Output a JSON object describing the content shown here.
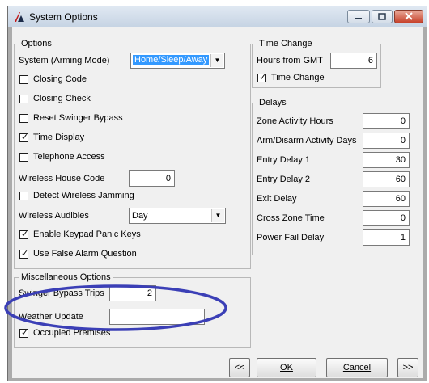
{
  "window": {
    "title": "System Options"
  },
  "options": {
    "legend": "Options",
    "system_label": "System (Arming Mode)",
    "system_value": "Home/Sleep/Away",
    "closing_code": {
      "label": "Closing Code",
      "checked": false
    },
    "closing_check": {
      "label": "Closing Check",
      "checked": false
    },
    "reset_swinger": {
      "label": "Reset Swinger Bypass",
      "checked": false
    },
    "time_display": {
      "label": "Time Display",
      "checked": true
    },
    "telephone_access": {
      "label": "Telephone Access",
      "checked": false
    },
    "house_code_label": "Wireless House Code",
    "house_code_value": "0",
    "detect_jamming": {
      "label": "Detect Wireless Jamming",
      "checked": false
    },
    "audibles_label": "Wireless Audibles",
    "audibles_value": "Day",
    "panic_keys": {
      "label": "Enable Keypad Panic Keys",
      "checked": true
    },
    "false_alarm": {
      "label": "Use False Alarm Question",
      "checked": true
    }
  },
  "misc": {
    "legend": "Miscellaneous Options",
    "swinger_trips_label": "Swinger Bypass Trips",
    "swinger_trips_value": "2",
    "weather_label": "Weather Update",
    "weather_value": "",
    "occupied": {
      "label": "Occupied Premises",
      "checked": true
    }
  },
  "time_change": {
    "legend": "Time Change",
    "gmt_label": "Hours from GMT",
    "gmt_value": "6",
    "time_change": {
      "label": "Time Change",
      "checked": true
    }
  },
  "delays": {
    "legend": "Delays",
    "rows": [
      {
        "label": "Zone Activity Hours",
        "value": "0"
      },
      {
        "label": "Arm/Disarm Activity Days",
        "value": "0"
      },
      {
        "label": "Entry Delay 1",
        "value": "30"
      },
      {
        "label": "Entry Delay 2",
        "value": "60"
      },
      {
        "label": "Exit Delay",
        "value": "60"
      },
      {
        "label": "Cross Zone Time",
        "value": "0"
      },
      {
        "label": "Power Fail Delay",
        "value": "1"
      }
    ]
  },
  "buttons": {
    "prev": "<<",
    "ok": "OK",
    "cancel": "Cancel",
    "next": ">>"
  },
  "annotation": {
    "color": "#3b3fb6"
  }
}
